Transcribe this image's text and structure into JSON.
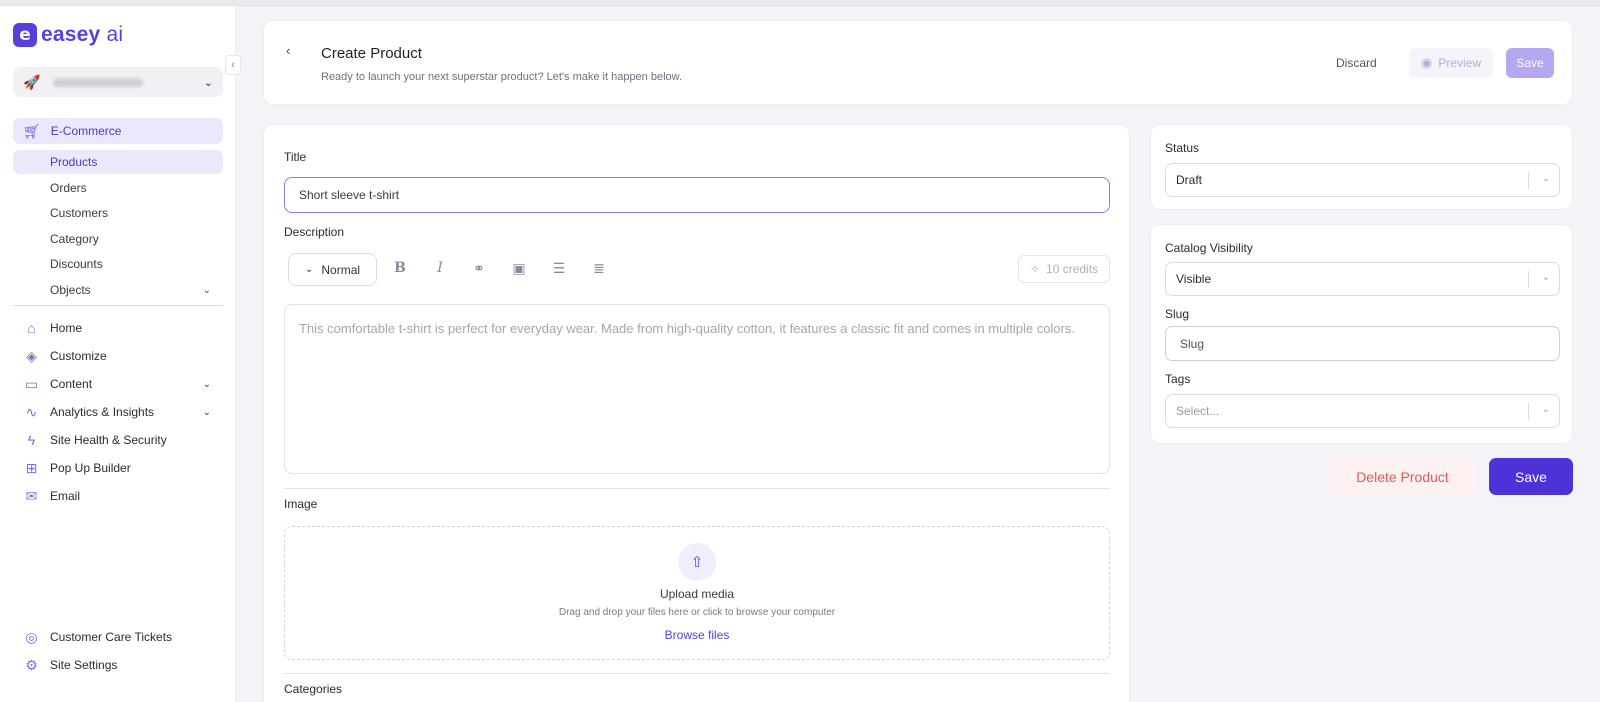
{
  "brand": {
    "logo_letter": "e",
    "name_bold": "easey",
    "name_light": " ai",
    "accent": "#5a3fe0"
  },
  "site_selector": {
    "icon": "rocket-icon"
  },
  "nav": {
    "ecommerce": "E-Commerce",
    "sub": [
      "Products",
      "Orders",
      "Customers",
      "Category",
      "Discounts",
      "Objects"
    ],
    "items": [
      "Home",
      "Customize",
      "Content",
      "Analytics & Insights",
      "Site Health & Security",
      "Pop Up Builder",
      "Email"
    ],
    "bottom": [
      "Customer Care Tickets",
      "Site Settings"
    ]
  },
  "header": {
    "title": "Create Product",
    "subtitle": "Ready to launch your next superstar product? Let's make it happen below.",
    "discard": "Discard",
    "preview": "Preview",
    "save": "Save"
  },
  "form": {
    "title_label": "Title",
    "title_value": "Short sleeve t-shirt",
    "description_label": "Description",
    "format_select": "Normal",
    "credits": "10 credits",
    "description_placeholder": "This comfortable t-shirt is perfect for everyday wear. Made from high-quality cotton, it features a classic fit and comes in multiple colors.",
    "image_label": "Image",
    "upload_title": "Upload media",
    "upload_sub": "Drag and drop your files here or click to browse your computer",
    "upload_link": "Browse files",
    "categories_label": "Categories"
  },
  "sidebar_right": {
    "status_label": "Status",
    "status_value": "Draft",
    "visibility_label": "Catalog Visibility",
    "visibility_value": "Visible",
    "slug_label": "Slug",
    "slug_placeholder": "Slug",
    "tags_label": "Tags",
    "tags_placeholder": "Select..."
  },
  "actions": {
    "delete": "Delete Product",
    "save": "Save"
  }
}
